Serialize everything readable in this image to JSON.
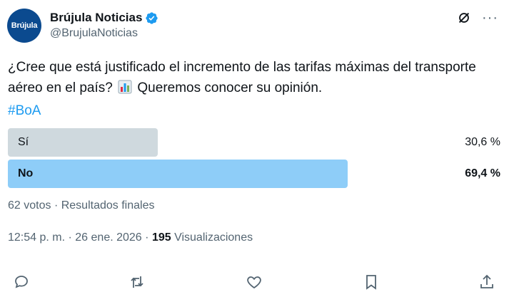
{
  "header": {
    "avatar_text": "Brújula",
    "name": "Brújula Noticias",
    "handle": "@BrujulaNoticias",
    "verified_icon": "verified-badge-icon",
    "grok_icon": "grok-icon",
    "more_label": "···"
  },
  "tweet": {
    "text_part1": "¿Cree que está justificado el incremento de las tarifas máximas del transporte aéreo en el país?",
    "emoji": "bar-chart-emoji",
    "text_part2": "Queremos conocer su opinión.",
    "hashtag": "#BoA"
  },
  "poll": {
    "options": [
      {
        "label": "Sí",
        "percent_label": "30,6 %",
        "share": 0.306,
        "color": "#cfd9de",
        "winner": false
      },
      {
        "label": "No",
        "percent_label": "69,4 %",
        "share": 0.694,
        "color": "#8ecdf8",
        "winner": true
      }
    ],
    "votes_label": "62 votos",
    "separator": "·",
    "status_label": "Resultados finales"
  },
  "meta": {
    "time": "12:54 p. m.",
    "separator": "·",
    "date": "26 ene. 2026",
    "views_count": "195",
    "views_label": "Visualizaciones"
  },
  "actions": [
    "reply-icon",
    "retweet-icon",
    "like-icon",
    "bookmark-icon",
    "share-icon"
  ],
  "colors": {
    "accent": "#1d9bf0",
    "muted_text": "#536471",
    "text": "#0f1419"
  }
}
